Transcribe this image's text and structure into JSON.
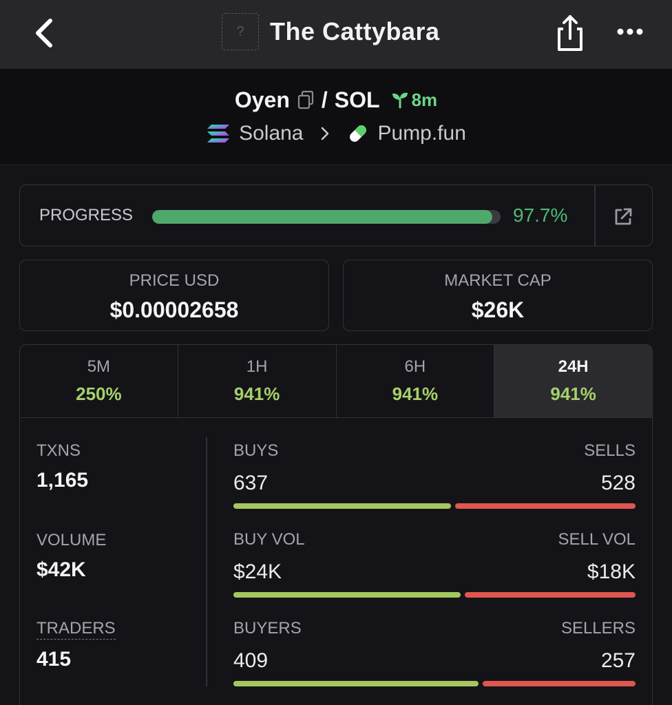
{
  "nav": {
    "title": "The Cattybara",
    "token_image_placeholder": "?"
  },
  "pair": {
    "base": "Oyen",
    "separator": "/",
    "quote": "SOL",
    "age": "8m",
    "chain": "Solana",
    "dex": "Pump.fun"
  },
  "progress": {
    "label": "PROGRESS",
    "value_text": "97.7%",
    "fraction": 0.977
  },
  "price": {
    "label": "PRICE USD",
    "value": "$0.00002658"
  },
  "market_cap": {
    "label": "MARKET CAP",
    "value": "$26K"
  },
  "timeframes": [
    {
      "label": "5M",
      "change": "250%"
    },
    {
      "label": "1H",
      "change": "941%"
    },
    {
      "label": "6H",
      "change": "941%"
    },
    {
      "label": "24H",
      "change": "941%",
      "active": true
    }
  ],
  "summary": {
    "txns_label": "TXNS",
    "txns_value": "1,165",
    "volume_label": "VOLUME",
    "volume_value": "$42K",
    "traders_label": "TRADERS",
    "traders_value": "415"
  },
  "splits": [
    {
      "left_label": "BUYS",
      "left_value": "637",
      "right_label": "SELLS",
      "right_value": "528",
      "buy_fraction": 0.547
    },
    {
      "left_label": "BUY VOL",
      "left_value": "$24K",
      "right_label": "SELL VOL",
      "right_value": "$18K",
      "buy_fraction": 0.571
    },
    {
      "left_label": "BUYERS",
      "left_value": "409",
      "right_label": "SELLERS",
      "right_value": "257",
      "buy_fraction": 0.614
    }
  ],
  "colors": {
    "accent_green": "#4fba72",
    "change_green": "#a6d16a",
    "buy_bar": "#a6c75f",
    "sell_bar": "#e0564f"
  },
  "icons": [
    "back-chevron-icon",
    "token-placeholder-icon",
    "share-icon",
    "more-dots-icon",
    "copy-icon",
    "seedling-icon",
    "solana-logo-icon",
    "chevron-right-icon",
    "pill-icon",
    "external-link-icon"
  ]
}
